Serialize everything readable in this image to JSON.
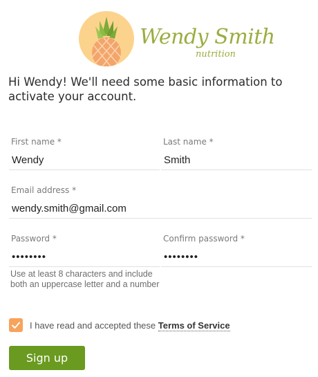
{
  "brand": {
    "name": "Wendy Smith",
    "tagline": "nutrition",
    "logo_icon": "pineapple-icon",
    "colors": {
      "circle": "#fcd38c",
      "text": "#9aad3f"
    }
  },
  "intro_text": "Hi Wendy! We'll need some basic information to activate your account.",
  "form": {
    "first_name": {
      "label": "First name *",
      "value": "Wendy"
    },
    "last_name": {
      "label": "Last name *",
      "value": "Smith"
    },
    "email": {
      "label": "Email address *",
      "value": "wendy.smith@gmail.com"
    },
    "password": {
      "label": "Password *",
      "value": "••••••••"
    },
    "confirm_password": {
      "label": "Confirm password *",
      "value": "••••••••"
    },
    "password_hint": "Use at least 8 characters and include both an uppercase letter and a number",
    "terms": {
      "checked": true,
      "text": "I have read and accepted these ",
      "link_label": "Terms of Service",
      "check_color": "#f7a35c"
    },
    "submit_label": "Sign up",
    "submit_color": "#6a9a1f"
  }
}
